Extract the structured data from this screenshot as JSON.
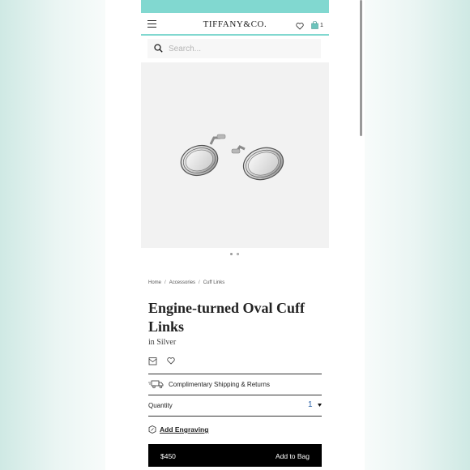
{
  "brand": {
    "logo_text": "TIFFANY&CO.",
    "accent_color": "#81d8d0"
  },
  "header": {
    "bag_count": "1"
  },
  "search": {
    "placeholder": "Search..."
  },
  "breadcrumb": [
    "Home",
    "Accessories",
    "Cuff Links"
  ],
  "product": {
    "title": "Engine-turned Oval Cuff Links",
    "material": "in Silver",
    "image_subject": "silver oval engine-turned cuff links"
  },
  "carousel": {
    "count": 2,
    "active_index": 0
  },
  "details": {
    "shipping": "Complimentary Shipping & Returns",
    "quantity_label": "Quantity",
    "quantity_value": "1",
    "engraving": "Add Engraving"
  },
  "purchase": {
    "price": "$450",
    "cta": "Add to Bag"
  },
  "icons": [
    "menu-icon",
    "heart-icon",
    "bag-icon",
    "search-icon",
    "gift-box-icon",
    "truck-icon",
    "chevron-down-icon",
    "engraving-icon"
  ]
}
